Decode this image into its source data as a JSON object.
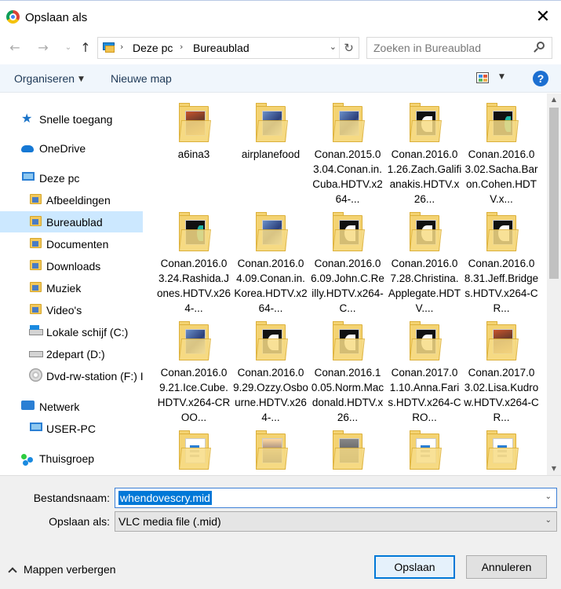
{
  "window": {
    "title": "Opslaan als"
  },
  "address": {
    "crumbs": [
      "Deze pc",
      "Bureaublad"
    ]
  },
  "search": {
    "placeholder": "Zoeken in Bureaublad"
  },
  "toolbar": {
    "organize": "Organiseren",
    "new_folder": "Nieuwe map"
  },
  "sidebar": {
    "items": [
      {
        "label": "Snelle toegang",
        "icon": "star-icon"
      },
      {
        "label": "OneDrive",
        "icon": "cloud-icon"
      },
      {
        "label": "Deze pc",
        "icon": "computer-icon"
      },
      {
        "label": "Afbeeldingen",
        "icon": "pictures-folder-icon"
      },
      {
        "label": "Bureaublad",
        "icon": "desktop-folder-icon",
        "selected": true
      },
      {
        "label": "Documenten",
        "icon": "documents-folder-icon"
      },
      {
        "label": "Downloads",
        "icon": "downloads-folder-icon"
      },
      {
        "label": "Muziek",
        "icon": "music-folder-icon"
      },
      {
        "label": "Video's",
        "icon": "videos-folder-icon"
      },
      {
        "label": "Lokale schijf (C:)",
        "icon": "system-drive-icon"
      },
      {
        "label": "2depart (D:)",
        "icon": "drive-icon"
      },
      {
        "label": "Dvd-rw-station (F:) I",
        "icon": "dvd-drive-icon"
      },
      {
        "label": "Netwerk",
        "icon": "network-icon"
      },
      {
        "label": "USER-PC",
        "icon": "computer-icon"
      },
      {
        "label": "Thuisgroep",
        "icon": "homegroup-icon"
      }
    ]
  },
  "files": [
    {
      "name": "a6ina3"
    },
    {
      "name": "airplanefood"
    },
    {
      "name": "Conan.2015.03.04.Conan.in.Cuba.HDTV.x264-..."
    },
    {
      "name": "Conan.2016.01.26.Zach.Galifianakis.HDTV.x26..."
    },
    {
      "name": "Conan.2016.03.02.Sacha.Baron.Cohen.HDTV.x..."
    },
    {
      "name": "Conan.2016.03.24.Rashida.Jones.HDTV.x264-..."
    },
    {
      "name": "Conan.2016.04.09.Conan.in.Korea.HDTV.x264-..."
    },
    {
      "name": "Conan.2016.06.09.John.C.Reilly.HDTV.x264-C..."
    },
    {
      "name": "Conan.2016.07.28.Christina.Applegate.HDTV...."
    },
    {
      "name": "Conan.2016.08.31.Jeff.Bridges.HDTV.x264-CR..."
    },
    {
      "name": "Conan.2016.09.21.Ice.Cube.HDTV.x264-CROO..."
    },
    {
      "name": "Conan.2016.09.29.Ozzy.Osbourne.HDTV.x264-..."
    },
    {
      "name": "Conan.2016.10.05.Norm.Macdonald.HDTV.x26..."
    },
    {
      "name": "Conan.2017.01.10.Anna.Faris.HDTV.x264-CRO..."
    },
    {
      "name": "Conan.2017.03.02.Lisa.Kudrow.HDTV.x264-CR..."
    },
    {
      "name": ""
    },
    {
      "name": ""
    },
    {
      "name": ""
    },
    {
      "name": ""
    },
    {
      "name": ""
    }
  ],
  "form": {
    "filename_label": "Bestandsnaam:",
    "filename_value": "whendovescry.mid",
    "filetype_label": "Opslaan als:",
    "filetype_value": "VLC media file (.mid)"
  },
  "footer": {
    "hide_folders": "Mappen verbergen",
    "save": "Opslaan",
    "cancel": "Annuleren"
  }
}
